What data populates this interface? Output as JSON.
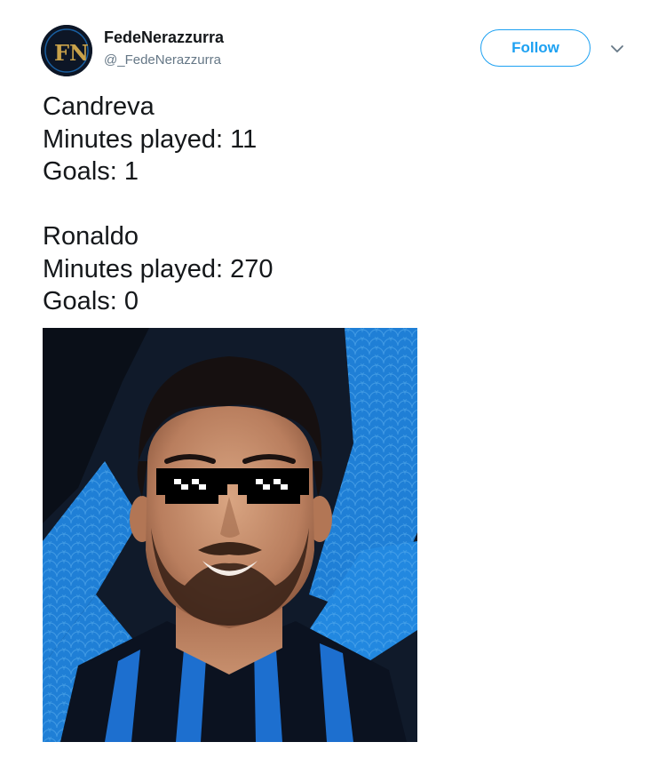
{
  "tweet": {
    "author": {
      "display_name": "FedeNerazzurra",
      "handle": "@_FedeNerazzurra",
      "avatar_icon": "fn-monogram-avatar",
      "avatar_monogram": "FN"
    },
    "follow_label": "Follow",
    "menu_icon": "chevron-down-icon",
    "body_lines": [
      "Candreva",
      "Minutes played: 11",
      "Goals: 1",
      "",
      "Ronaldo",
      "Minutes played: 270",
      "Goals: 0"
    ],
    "media": {
      "kind": "photo",
      "subject": "smiling-man-with-pixel-sunglasses"
    }
  },
  "colors": {
    "accent": "#1da1f2",
    "text": "#14171a",
    "secondary_text": "#657786",
    "background": "#ffffff",
    "inter_blue": "#1f7fd6",
    "inter_black": "#0d1626"
  }
}
